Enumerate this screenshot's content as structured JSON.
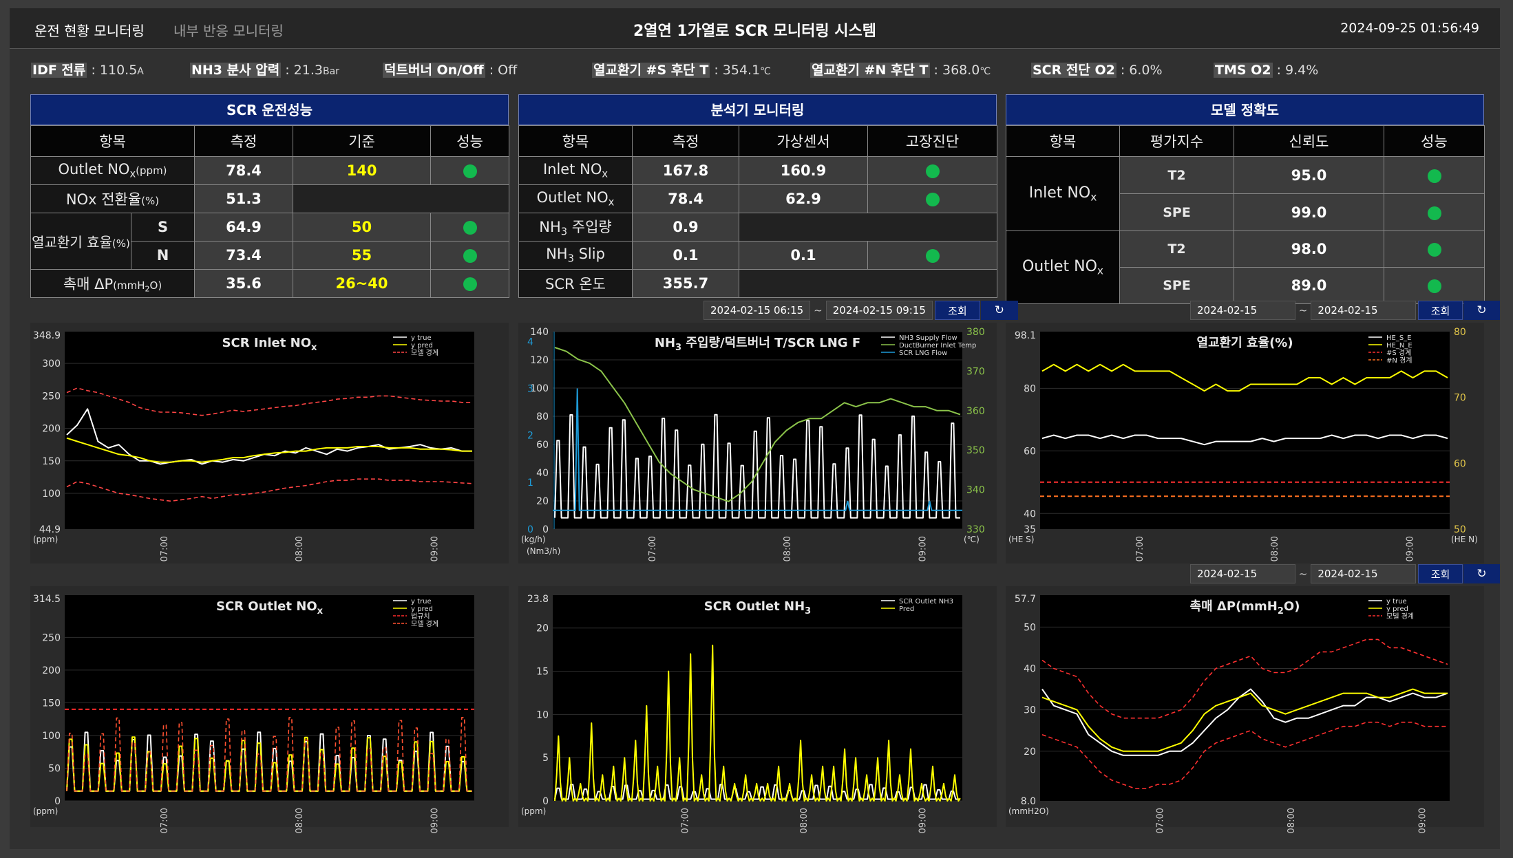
{
  "header": {
    "tab_active": "운전 현황 모니터링",
    "tab_inactive": "내부 반응 모니터링",
    "title": "2열연 1가열로 SCR 모니터링 시스템",
    "datetime": "2024-09-25 01:56:49"
  },
  "status": [
    {
      "label": "IDF 전류",
      "value": " : 110.5",
      "unit": "A"
    },
    {
      "label": "NH3 분사 압력",
      "value": " : 21.3",
      "unit": "Bar"
    },
    {
      "label": "덕트버너 On/Off",
      "value": " : Off",
      "unit": ""
    },
    {
      "label": "열교환기 #S 후단 T",
      "value": " : 354.1",
      "unit": "℃"
    },
    {
      "label": "열교환기 #N 후단 T",
      "value": " : 368.0",
      "unit": "℃"
    },
    {
      "label": "SCR 전단 O2",
      "value": " : 6.0%",
      "unit": ""
    },
    {
      "label": "TMS O2",
      "value": " : 9.4%",
      "unit": ""
    }
  ],
  "panel1": {
    "title": "SCR 운전성능",
    "headers": [
      "항목",
      "측정",
      "기준",
      "성능"
    ],
    "r1": {
      "label": "Outlet NO",
      "sub": "x",
      "unit": "(ppm)",
      "measure": "78.4",
      "standard": "140"
    },
    "r2": {
      "label": "NOx 전환율",
      "unit": "(%)",
      "measure": "51.3"
    },
    "r3": {
      "label": "열교환기 효율",
      "unit": "(%)",
      "s": "S",
      "s_measure": "64.9",
      "s_standard": "50",
      "n": "N",
      "n_measure": "73.4",
      "n_standard": "55"
    },
    "r4": {
      "label": "촉매 ΔP",
      "unit": "(mmH",
      "unit_sub": "2",
      "unit_end": "O)",
      "measure": "35.6",
      "standard": "26~40"
    }
  },
  "panel2": {
    "title": "분석기 모니터링",
    "headers": [
      "항목",
      "측정",
      "가상센서",
      "고장진단"
    ],
    "rows": [
      {
        "label": "Inlet NO",
        "sub": "x",
        "measure": "167.8",
        "virtual": "160.9"
      },
      {
        "label": "Outlet NO",
        "sub": "x",
        "measure": "78.4",
        "virtual": "62.9"
      },
      {
        "label": "NH",
        "sub": "3",
        "post": " 주입량",
        "measure": "0.9"
      },
      {
        "label": "NH",
        "sub": "3",
        "post": " Slip",
        "measure": "0.1",
        "virtual": "0.1"
      },
      {
        "label": "SCR 온도",
        "measure": "355.7"
      }
    ]
  },
  "panel3": {
    "title": "모델 정확도",
    "headers": [
      "항목",
      "평가지수",
      "신뢰도",
      "성능"
    ],
    "g1": {
      "label": "Inlet NO",
      "sub": "x",
      "a": "T2",
      "a_val": "95.0",
      "b": "SPE",
      "b_val": "99.0"
    },
    "g2": {
      "label": "Outlet NO",
      "sub": "x",
      "a": "T2",
      "a_val": "98.0",
      "b": "SPE",
      "b_val": "89.0"
    }
  },
  "controls": {
    "from": "2024-02-15 06:15",
    "sep": "~",
    "to": "2024-02-15 09:15",
    "button": "조회",
    "refresh": "↻"
  },
  "colors": {
    "navy": "#0b2470",
    "good": "#13b94e",
    "standard": "#ffff00"
  },
  "chart_data": [
    {
      "id": "inlet",
      "type": "line",
      "title": "SCR Inlet NO",
      "title_sub": "x",
      "ylabel": "(ppm)",
      "ylim": [
        44.9,
        348.9
      ],
      "y_top_label": "348.9",
      "y_bottom_label": "44.9",
      "yticks": [
        100,
        150,
        200,
        250,
        300
      ],
      "xticks": [
        "07:00",
        "08:00",
        "09:00"
      ],
      "xtick_pos": [
        0.25,
        0.58,
        0.91
      ],
      "series": [
        {
          "name": "y true",
          "color": "#ffffff",
          "values": [
            190,
            205,
            230,
            180,
            170,
            175,
            160,
            150,
            150,
            145,
            148,
            150,
            152,
            145,
            150,
            148,
            152,
            150,
            155,
            160,
            158,
            165,
            162,
            170,
            165,
            160,
            168,
            165,
            170,
            172,
            175,
            168,
            170,
            172,
            175,
            170,
            168,
            170,
            165,
            165
          ]
        },
        {
          "name": "y pred",
          "color": "#ffff00",
          "values": [
            185,
            180,
            175,
            170,
            165,
            160,
            158,
            155,
            150,
            148,
            148,
            150,
            150,
            148,
            150,
            152,
            155,
            155,
            158,
            160,
            162,
            163,
            165,
            165,
            168,
            170,
            170,
            170,
            172,
            172,
            172,
            170,
            170,
            170,
            168,
            168,
            168,
            167,
            165,
            165
          ]
        },
        {
          "name": "모델 경계",
          "color": "#ff4444",
          "dashed": true,
          "values": [
            255,
            262,
            258,
            255,
            250,
            245,
            240,
            232,
            228,
            225,
            225,
            224,
            222,
            220,
            222,
            225,
            228,
            226,
            228,
            230,
            232,
            234,
            235,
            238,
            240,
            242,
            245,
            246,
            248,
            248,
            250,
            250,
            248,
            246,
            244,
            243,
            242,
            242,
            240,
            240
          ]
        },
        {
          "name": "",
          "color": "#ff4444",
          "dashed": true,
          "values": [
            110,
            118,
            115,
            110,
            105,
            100,
            98,
            95,
            92,
            90,
            88,
            90,
            92,
            95,
            92,
            95,
            98,
            98,
            100,
            102,
            105,
            108,
            110,
            112,
            115,
            118,
            120,
            120,
            122,
            122,
            122,
            120,
            120,
            120,
            118,
            118,
            118,
            117,
            116,
            115
          ]
        }
      ]
    },
    {
      "id": "nh3",
      "type": "line",
      "title": "NH",
      "title_sub": "3",
      "title_post": " 주입량/덕트버너 T/SCR LNG F",
      "ylabel": "(kg/h)",
      "ylabel2": "(Nm3/h)",
      "yright_label": "(℃)",
      "ylim": [
        0,
        140
      ],
      "yticks": [
        0,
        20,
        40,
        60,
        80,
        100,
        120,
        140
      ],
      "y_far_ticks": [
        0,
        1,
        2,
        3,
        4
      ],
      "yright_lim": [
        330,
        380
      ],
      "yright_ticks": [
        330,
        340,
        350,
        360,
        370,
        380
      ],
      "xticks": [
        "07:00",
        "08:00",
        "09:00"
      ],
      "xtick_pos": [
        0.25,
        0.58,
        0.91
      ],
      "series": [
        {
          "name": "NH3 Supply Flow",
          "color": "#ffffff",
          "peak": 130,
          "base": 8,
          "peaks": 31
        },
        {
          "name": "DuctBurner Inlet Temp",
          "color": "#8bc34a",
          "values": [
            376,
            375,
            373,
            372,
            370,
            366,
            362,
            357,
            352,
            347,
            344,
            342,
            340,
            339,
            338,
            337,
            339,
            342,
            347,
            352,
            355,
            357,
            358,
            358,
            360,
            362,
            361,
            362,
            362,
            363,
            362,
            361,
            361,
            360,
            360,
            359
          ]
        },
        {
          "name": "SCR LNG Flow",
          "color": "#1e9bd7",
          "base": 0.4,
          "spikes": [
            {
              "at": 0.06,
              "v": 3.0
            },
            {
              "at": 0.72,
              "v": 0.6
            },
            {
              "at": 0.92,
              "v": 0.6
            }
          ]
        }
      ]
    },
    {
      "id": "he",
      "type": "line",
      "title": "열교환기 효율(%)",
      "ylabel": "(HE S)",
      "yright_label": "(HE N)",
      "ylim": [
        35,
        98.1
      ],
      "y_top_label": "98.1",
      "y_bottom_label": "35",
      "yticks": [
        40,
        60,
        80
      ],
      "yright_lim": [
        50,
        80
      ],
      "yright_ticks": [
        50,
        60,
        70,
        80
      ],
      "xticks": [
        "07:00",
        "08:00",
        "09:00"
      ],
      "xtick_pos": [
        0.25,
        0.58,
        0.91
      ],
      "series": [
        {
          "name": "HE_S_E",
          "color": "#ffffff",
          "values": [
            64,
            65,
            64,
            65,
            65,
            64,
            65,
            64,
            65,
            65,
            64,
            64,
            64,
            63,
            62,
            63,
            63,
            63,
            63,
            64,
            63,
            64,
            64,
            64,
            64,
            65,
            64,
            65,
            65,
            64,
            65,
            65,
            64,
            65,
            65,
            64
          ]
        },
        {
          "name": "HE_N_E",
          "color": "#ffff00",
          "axis": "right",
          "values": [
            74,
            75,
            74,
            75,
            74,
            75,
            74,
            75,
            74,
            74,
            74,
            74,
            73,
            72,
            71,
            72,
            71,
            71,
            72,
            72,
            72,
            72,
            72,
            73,
            73,
            72,
            73,
            72,
            73,
            73,
            73,
            74,
            73,
            74,
            74,
            73
          ]
        },
        {
          "name": "#S 경계",
          "color": "#ff3030",
          "dashed": true,
          "const": 50
        },
        {
          "name": "#N 경계",
          "color": "#ff7020",
          "dashed": true,
          "const": 45.5
        }
      ]
    },
    {
      "id": "outnox",
      "type": "line",
      "title": "SCR Outlet NO",
      "title_sub": "x",
      "ylabel": "(ppm)",
      "ylim": [
        0,
        314.5
      ],
      "y_top_label": "314.5",
      "yticks": [
        0,
        50,
        100,
        150,
        200,
        250
      ],
      "xticks": [
        "07:00",
        "08:00",
        "09:00"
      ],
      "xtick_pos": [
        0.25,
        0.58,
        0.91
      ],
      "series": [
        {
          "name": "y true",
          "color": "#ffffff",
          "peak": 120,
          "peaks": 26
        },
        {
          "name": "y pred",
          "color": "#ffff00",
          "peak": 110,
          "peaks": 26
        },
        {
          "name": "법규치",
          "color": "#ff2a2a",
          "dashed": true,
          "const": 140
        },
        {
          "name": "모델 경계",
          "color": "#ff5030",
          "dashed": true,
          "peak": 150,
          "peaks": 26
        }
      ]
    },
    {
      "id": "outnh3",
      "type": "line",
      "title": "SCR Outlet NH",
      "title_sub": "3",
      "ylabel": "(ppm)",
      "ylim": [
        0,
        23.8
      ],
      "y_top_label": "23.8",
      "yticks": [
        0,
        5,
        10,
        15,
        20
      ],
      "xticks": [
        "07:00",
        "08:00",
        "09:00"
      ],
      "xtick_pos": [
        0.33,
        0.62,
        0.91
      ],
      "series": [
        {
          "name": "SCR Outlet NH3",
          "color": "#ffffff",
          "peak": 3,
          "peaks": 30
        },
        {
          "name": "Pred",
          "color": "#ffff00",
          "peaks_list": [
            7.5,
            5,
            2,
            9,
            3,
            4,
            5,
            7,
            11,
            4,
            15,
            5,
            17,
            3,
            18,
            4,
            2,
            3,
            2,
            2,
            4,
            2,
            7,
            3,
            4,
            4,
            6,
            5,
            3,
            5,
            7,
            3,
            6,
            2,
            4,
            2,
            3
          ]
        }
      ]
    },
    {
      "id": "dp",
      "type": "line",
      "title": "촉매 ΔP(mmH",
      "title_sub": "2",
      "title_post": "O)",
      "ylabel": "(mmH2O)",
      "ylim": [
        8.0,
        57.7
      ],
      "y_top_label": "57.7",
      "y_bottom_label": "8.0",
      "yticks": [
        20,
        30,
        40,
        50
      ],
      "xticks": [
        "07:00",
        "08:00",
        "09:00"
      ],
      "xtick_pos": [
        0.3,
        0.62,
        0.94
      ],
      "series": [
        {
          "name": "y true",
          "color": "#ffffff",
          "values": [
            35,
            31,
            30,
            29,
            24,
            22,
            20,
            19,
            19,
            19,
            19,
            20,
            20,
            22,
            25,
            28,
            30,
            33,
            35,
            32,
            28,
            27,
            28,
            28,
            29,
            30,
            31,
            31,
            33,
            33,
            32,
            33,
            34,
            33,
            33,
            34
          ]
        },
        {
          "name": "y pred",
          "color": "#ffff00",
          "values": [
            33,
            32,
            31,
            30,
            26,
            23,
            21,
            20,
            20,
            20,
            20,
            21,
            22,
            25,
            29,
            31,
            32,
            33,
            34,
            31,
            30,
            29,
            30,
            31,
            32,
            33,
            34,
            34,
            34,
            33,
            33,
            34,
            35,
            34,
            34,
            34
          ]
        },
        {
          "name": "모델 경계",
          "color": "#ff3030",
          "dashed": true,
          "values": [
            42,
            40,
            39,
            38,
            34,
            31,
            29,
            28,
            28,
            28,
            28,
            29,
            30,
            33,
            37,
            40,
            41,
            42,
            43,
            40,
            39,
            39,
            40,
            42,
            44,
            44,
            45,
            46,
            47,
            47,
            45,
            45,
            44,
            43,
            42,
            41
          ]
        },
        {
          "name": "",
          "color": "#ff3030",
          "dashed": true,
          "values": [
            24,
            23,
            22,
            21,
            18,
            15,
            13,
            12,
            11,
            11,
            12,
            12,
            13,
            16,
            20,
            22,
            23,
            24,
            25,
            23,
            22,
            21,
            22,
            23,
            24,
            25,
            26,
            26,
            27,
            27,
            26,
            27,
            27,
            26,
            26,
            26
          ]
        }
      ]
    }
  ]
}
